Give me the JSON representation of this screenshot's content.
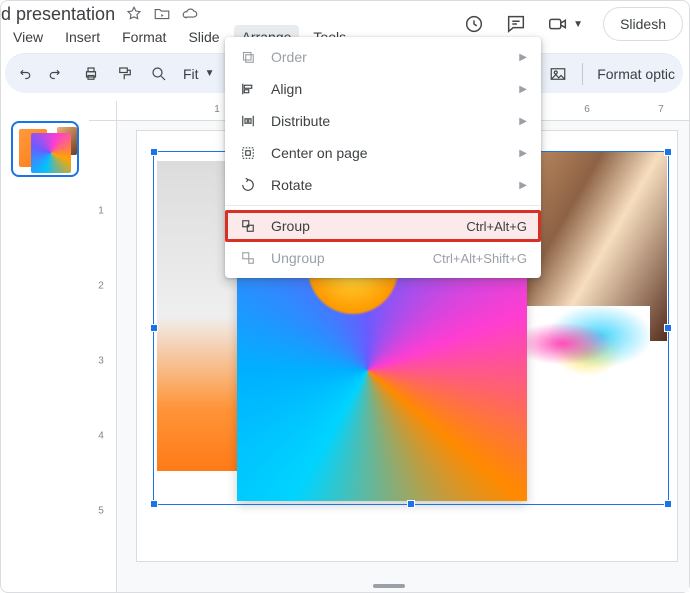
{
  "doc": {
    "title": "d presentation"
  },
  "menubar": {
    "items": [
      "View",
      "Insert",
      "Format",
      "Slide",
      "Arrange",
      "Tools"
    ],
    "overflow": "…"
  },
  "toolbar": {
    "fit": "Fit",
    "format_options": "Format optic"
  },
  "slideshow": {
    "label": "Slidesh"
  },
  "h_ruler": [
    "1",
    "6",
    "7"
  ],
  "v_ruler": [
    "1",
    "2",
    "3",
    "4",
    "5"
  ],
  "arrange_menu": {
    "order": {
      "label": "Order"
    },
    "align": {
      "label": "Align"
    },
    "distribute": {
      "label": "Distribute"
    },
    "center": {
      "label": "Center on page"
    },
    "rotate": {
      "label": "Rotate"
    },
    "group": {
      "label": "Group",
      "shortcut": "Ctrl+Alt+G"
    },
    "ungroup": {
      "label": "Ungroup",
      "shortcut": "Ctrl+Alt+Shift+G"
    }
  }
}
